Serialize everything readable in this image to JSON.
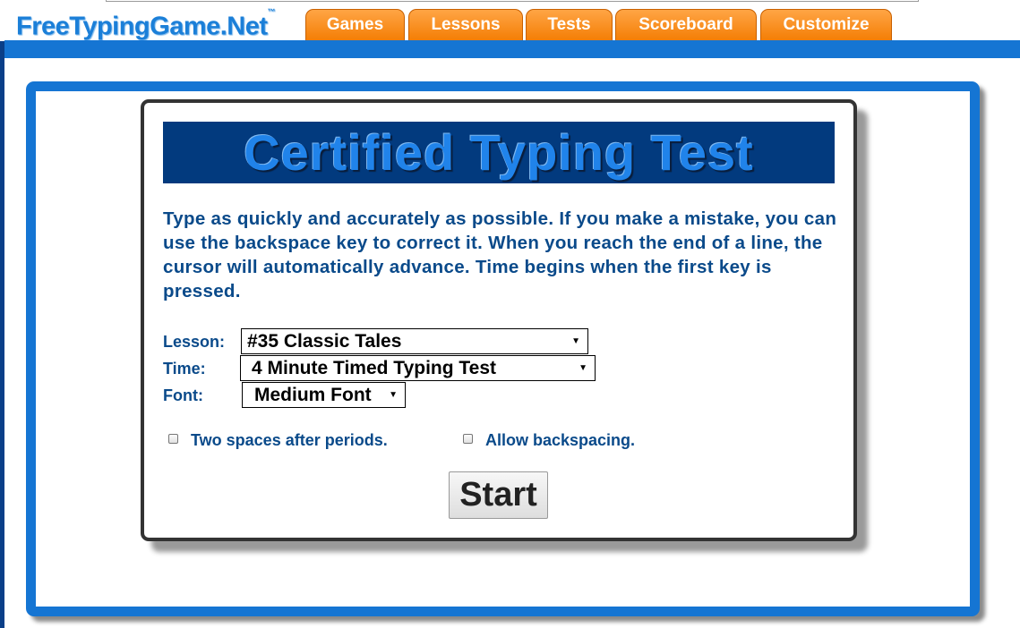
{
  "header": {
    "logo_text": "FreeTypingGame.Net",
    "logo_tm": "™",
    "tabs": [
      {
        "label": "Games"
      },
      {
        "label": "Lessons"
      },
      {
        "label": "Tests"
      },
      {
        "label": "Scoreboard"
      },
      {
        "label": "Customize"
      }
    ]
  },
  "main": {
    "title": "Certified Typing Test",
    "instructions": "Type as quickly and accurately as possible. If you make a mistake, you can use the backspace key to correct it. When you reach the end of a line, the cursor will automatically advance. Time begins when the first key is pressed.",
    "lesson": {
      "label": "Lesson:",
      "value": "#35 Classic Tales"
    },
    "time": {
      "label": "Time:",
      "value": "4 Minute Timed Typing Test"
    },
    "font": {
      "label": "Font:",
      "value": "Medium Font"
    },
    "options": {
      "two_spaces_label": "Two spaces after periods.",
      "two_spaces_checked": false,
      "backspace_label": "Allow backspacing.",
      "backspace_checked": false
    },
    "start_label": "Start"
  },
  "colors": {
    "accent_blue": "#1575d3",
    "banner_navy": "#023a7e",
    "tab_orange": "#f47e05",
    "text_navy": "#0a4a8a"
  },
  "icons": {
    "dropdown": "triangle-down-icon"
  }
}
